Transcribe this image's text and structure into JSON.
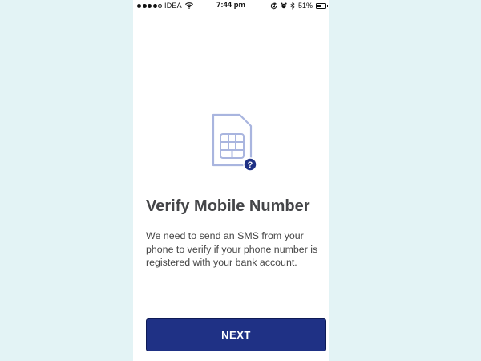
{
  "status_bar": {
    "carrier": "IDEA",
    "time": "7:44 pm",
    "battery_percent": "51%",
    "battery_level": 0.51,
    "signal_bars_filled": 4,
    "signal_bars_total": 5,
    "icons": [
      "wifi-icon",
      "orientation-lock-icon",
      "alarm-icon",
      "bluetooth-icon",
      "battery-icon"
    ]
  },
  "main": {
    "illustration_icon": "sim-card-icon",
    "badge_icon": "question-mark-icon",
    "badge_text": "?",
    "title": "Verify Mobile Number",
    "description": "We need to send an SMS from your phone to verify if your phone number is registered with your bank account.",
    "next_button_label": "NEXT"
  },
  "colors": {
    "page_background": "#e3f3f5",
    "screen_background": "#ffffff",
    "primary_button": "#1f3185",
    "sim_outline": "#a9b5df",
    "badge": "#1f3185",
    "title_text": "#444548"
  }
}
